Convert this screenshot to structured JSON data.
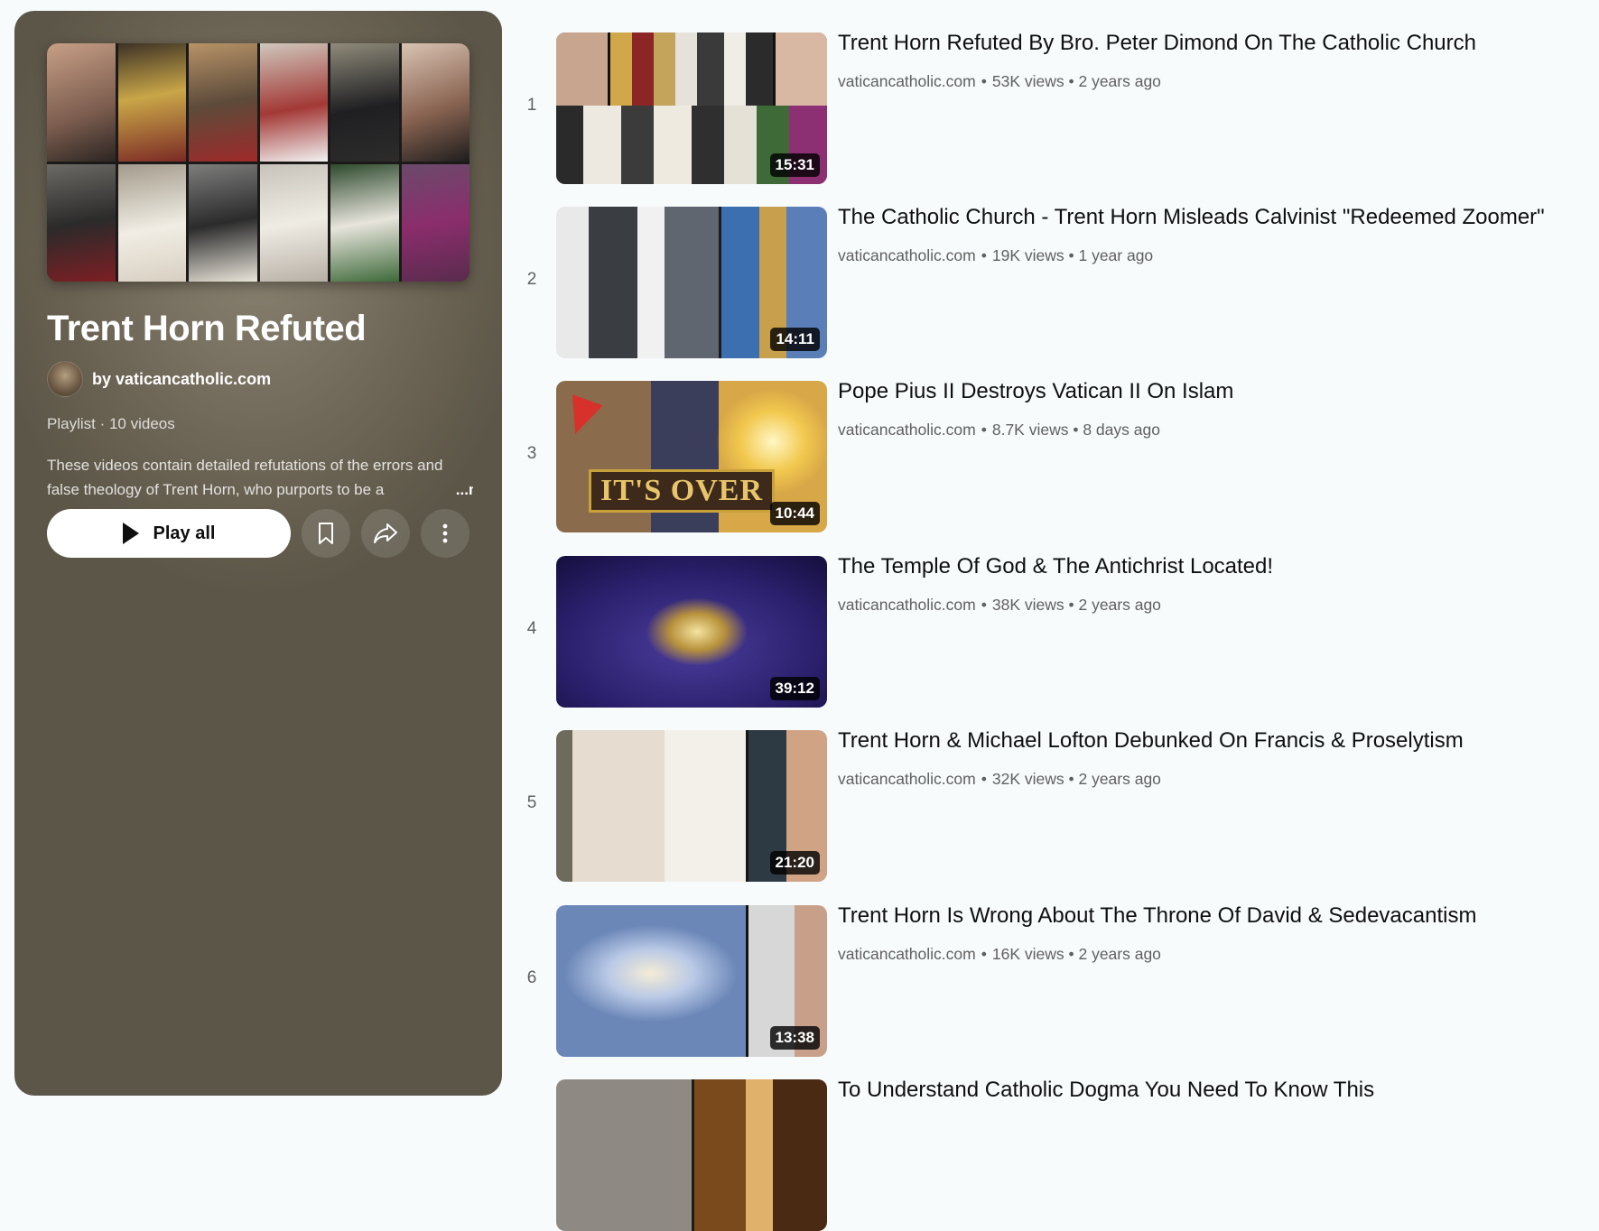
{
  "playlist": {
    "title": "Trent Horn Refuted",
    "owner_text": "by vaticancatholic.com",
    "meta": "Playlist · 10 videos",
    "description_line1": "These videos contain detailed refutations of the errors and",
    "description_line2": "false theology of Trent Horn, who purports to be a",
    "description_fade": "",
    "more_label": "...more",
    "play_all_label": "Play all"
  },
  "videos": [
    {
      "index": "1",
      "title": "Trent Horn Refuted By Bro. Peter Dimond On The Catholic Church",
      "channel": "vaticancatholic.com",
      "stats": "53K views • 2 years ago",
      "duration": "15:31"
    },
    {
      "index": "2",
      "title": "The Catholic Church - Trent Horn Misleads Calvinist \"Redeemed Zoomer\"",
      "channel": "vaticancatholic.com",
      "stats": "19K views • 1 year ago",
      "duration": "14:11"
    },
    {
      "index": "3",
      "title": "Pope Pius II Destroys Vatican II On Islam",
      "channel": "vaticancatholic.com",
      "stats": "8.7K views • 8 days ago",
      "duration": "10:44",
      "overlay_text": "IT'S OVER"
    },
    {
      "index": "4",
      "title": "The Temple Of God & The Antichrist Located!",
      "channel": "vaticancatholic.com",
      "stats": "38K views • 2 years ago",
      "duration": "39:12"
    },
    {
      "index": "5",
      "title": "Trent Horn & Michael Lofton Debunked On Francis & Proselytism",
      "channel": "vaticancatholic.com",
      "stats": "32K views • 2 years ago",
      "duration": "21:20"
    },
    {
      "index": "6",
      "title": "Trent Horn Is Wrong About The Throne Of David & Sedevacantism",
      "channel": "vaticancatholic.com",
      "stats": "16K views • 2 years ago",
      "duration": "13:38"
    },
    {
      "index": "",
      "title": "To Understand Catholic Dogma You Need To Know This",
      "channel": "",
      "stats": "",
      "duration": ""
    }
  ],
  "icons": {
    "play": "play-icon",
    "save": "bookmark-icon",
    "share": "share-icon",
    "more": "more-vert-icon"
  },
  "colors": {
    "page_background": "#f7fbfc",
    "panel_background": "#5c5648",
    "title_text": "#0f0f0f",
    "meta_text": "#606060"
  }
}
